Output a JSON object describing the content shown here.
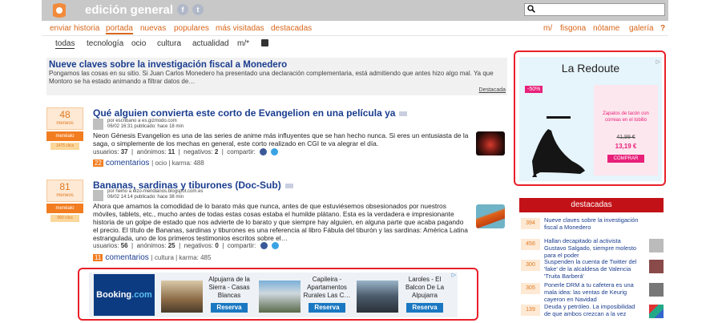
{
  "header": {
    "site_title": "edición general",
    "search": {
      "value": "",
      "placeholder": ""
    }
  },
  "nav": {
    "left": [
      "enviar historia",
      "portada",
      "nuevas",
      "populares",
      "más visitadas",
      "destacadas"
    ],
    "right": [
      "m/",
      "fisgona",
      "nótame",
      "galería",
      "?"
    ],
    "active": "portada"
  },
  "subnav": {
    "items": [
      "todas",
      "tecnología",
      "ocio",
      "cultura",
      "actualidad",
      "m/*"
    ],
    "active": "todas"
  },
  "featured": {
    "title": "Nueve claves sobre la investigación fiscal a Monedero",
    "description": "Pongamos las cosas en su sitio. Si Juan Carlos Monedero ha presentado una declaración complementaria, está admitiendo que antes hizo algo mal. Ya que Montoro se ha estado animando a filtrar datos de…",
    "link": "Destacada"
  },
  "stories": [
    {
      "votes": "48",
      "votes_label": "meneos",
      "vote_button": "menéalo",
      "clicks": "1475 clics",
      "title": "Qué alguien convierta este corto de Evangelion en una película ya",
      "meta_by": "por escribano a es.gizmodo.com",
      "meta_time": "06/02 16:31 publicado: hace 18 min",
      "body": "Neon Génesis Evangelion es una de las series de anime más influyentes que se han hecho nunca. Si eres un entusiasta de la saga, o simplemente de los mechas en general, este corto realizado en CGI te va alegrar el día.",
      "usuarios": "37",
      "anonimos": "11",
      "negativos": "2",
      "compartir": "compartir:",
      "comments_count": "22",
      "comments_label": "comentarios",
      "category": "ocio",
      "karma": "karma: 488"
    },
    {
      "votes": "81",
      "votes_label": "meneos",
      "vote_button": "menéalo",
      "clicks": "990 clics",
      "title": "Bananas, sardinas y tiburones (Doc-Sub)",
      "meta_by": "por heiho a elzo-meridianos.blogspot.com.es",
      "meta_time": "06/02 14:14 publicado: hace 38 min",
      "body": "Ahora que amamos la comodidad de lo barato más que nunca, antes de que estuviésemos obsesionados por nuestros móviles, tablets, etc., mucho antes de todas estas cosas estaba el humilde plátano. Esta es la verdadera e impresionante historia de un golpe de estado que nos advierte de lo barato y que siempre hay alguien, en alguna parte que acaba pagando el precio. El título de Bananas, sardinas y tiburones es una referencia al libro Fábula del tiburón y las sardinas: América Latina estrangulada, uno de los primeros testimonios escritos sobre el…",
      "usuarios": "56",
      "anonimos": "25",
      "negativos": "0",
      "compartir": "compartir:",
      "comments_count": "11",
      "comments_label": "comentarios",
      "category": "cultura",
      "karma": "karma: 485"
    }
  ],
  "labels": {
    "usuarios": "usuarios:",
    "anonimos": "anónimos:",
    "negativos": "negativos:"
  },
  "ad_right": {
    "brand": "La Redoute",
    "discount": "-50%",
    "description": "Zapatos de tacón con correas en el tobillo",
    "old_price": "41,99 €",
    "new_price": "13,19 €",
    "button": "COMPRAR"
  },
  "destacadas": {
    "heading": "destacadas",
    "items": [
      {
        "count": "394",
        "text": "Nueve claves sobre la investigación fiscal a Monedero"
      },
      {
        "count": "456",
        "text": "Hallan decapitado al activista Gustavo Salgado, siempre molesto para el poder"
      },
      {
        "count": "300",
        "text": "Suspenden la cuenta de Twitter del 'fake' de la alcaldesa de Valencia 'Truita Barberá'"
      },
      {
        "count": "305",
        "text": "Ponerle DRM a tu cafetera es una mala idea: las ventas de Keurig cayeron en Navidad"
      },
      {
        "count": "139",
        "text": "Deuda y petróleo. La imposibilidad de que ambos crezcan a la vez"
      }
    ]
  },
  "ad_bottom": {
    "brand_a": "Booking",
    "brand_b": ".com",
    "offers": [
      {
        "name": "Alpujarra de la Sierra - Casas Blancas",
        "button": "Reserva"
      },
      {
        "name": "Capileira - Apartamentos Rurales Las C…",
        "button": "Reserva"
      },
      {
        "name": "Laroles - El Balcon De La Alpujarra",
        "button": "Reserva"
      }
    ]
  },
  "colors": {
    "accent": "#d9661a",
    "link": "#1a3d8f",
    "ad_border": "#e8202a",
    "destacadas": "#c21217"
  }
}
